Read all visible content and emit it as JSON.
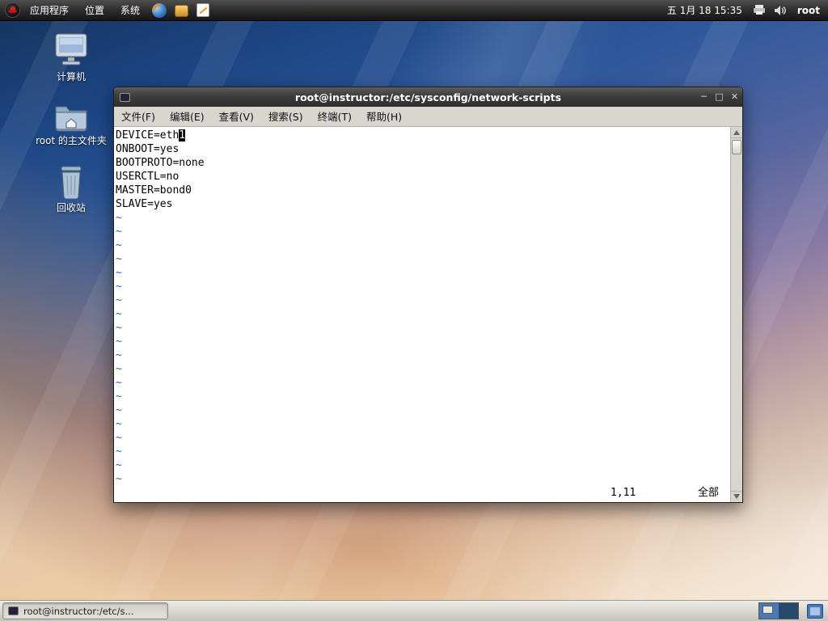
{
  "colors": {
    "accent_blue": "#3465a4",
    "tilde_blue": "#3465a4",
    "titlebar_bg": "#3c3c3c",
    "menubar_bg": "#d9d6cf",
    "workspace_active": "#4a78b8",
    "wallpaper_top": "#1d4684",
    "wallpaper_bottom": "#f9f4eb"
  },
  "panel": {
    "menus": [
      "应用程序",
      "位置",
      "系统"
    ],
    "clock": "五 1月 18 15:35",
    "user": "root"
  },
  "desktop_icons": [
    "计算机",
    "root 的主文件夹",
    "回收站"
  ],
  "window": {
    "title": "root@instructor:/etc/sysconfig/network-scripts",
    "controls": {
      "minimize": "─",
      "maximize": "□",
      "close": "✕"
    },
    "menu_items": [
      "文件(F)",
      "编辑(E)",
      "查看(V)",
      "搜索(S)",
      "终端(T)",
      "帮助(H)"
    ],
    "editor": {
      "first_line_before_cursor": "DEVICE=eth",
      "cursor_char": "1",
      "lines": [
        "ONBOOT=yes",
        "BOOTPROTO=none",
        "USERCTL=no",
        "MASTER=bond0",
        "SLAVE=yes"
      ],
      "tilde_char": "~",
      "tilde_count": 20,
      "ruler": "1,11",
      "position_indicator": "全部"
    }
  },
  "taskbar": {
    "task_button": "root@instructor:/etc/s...",
    "workspace_count": 2
  }
}
